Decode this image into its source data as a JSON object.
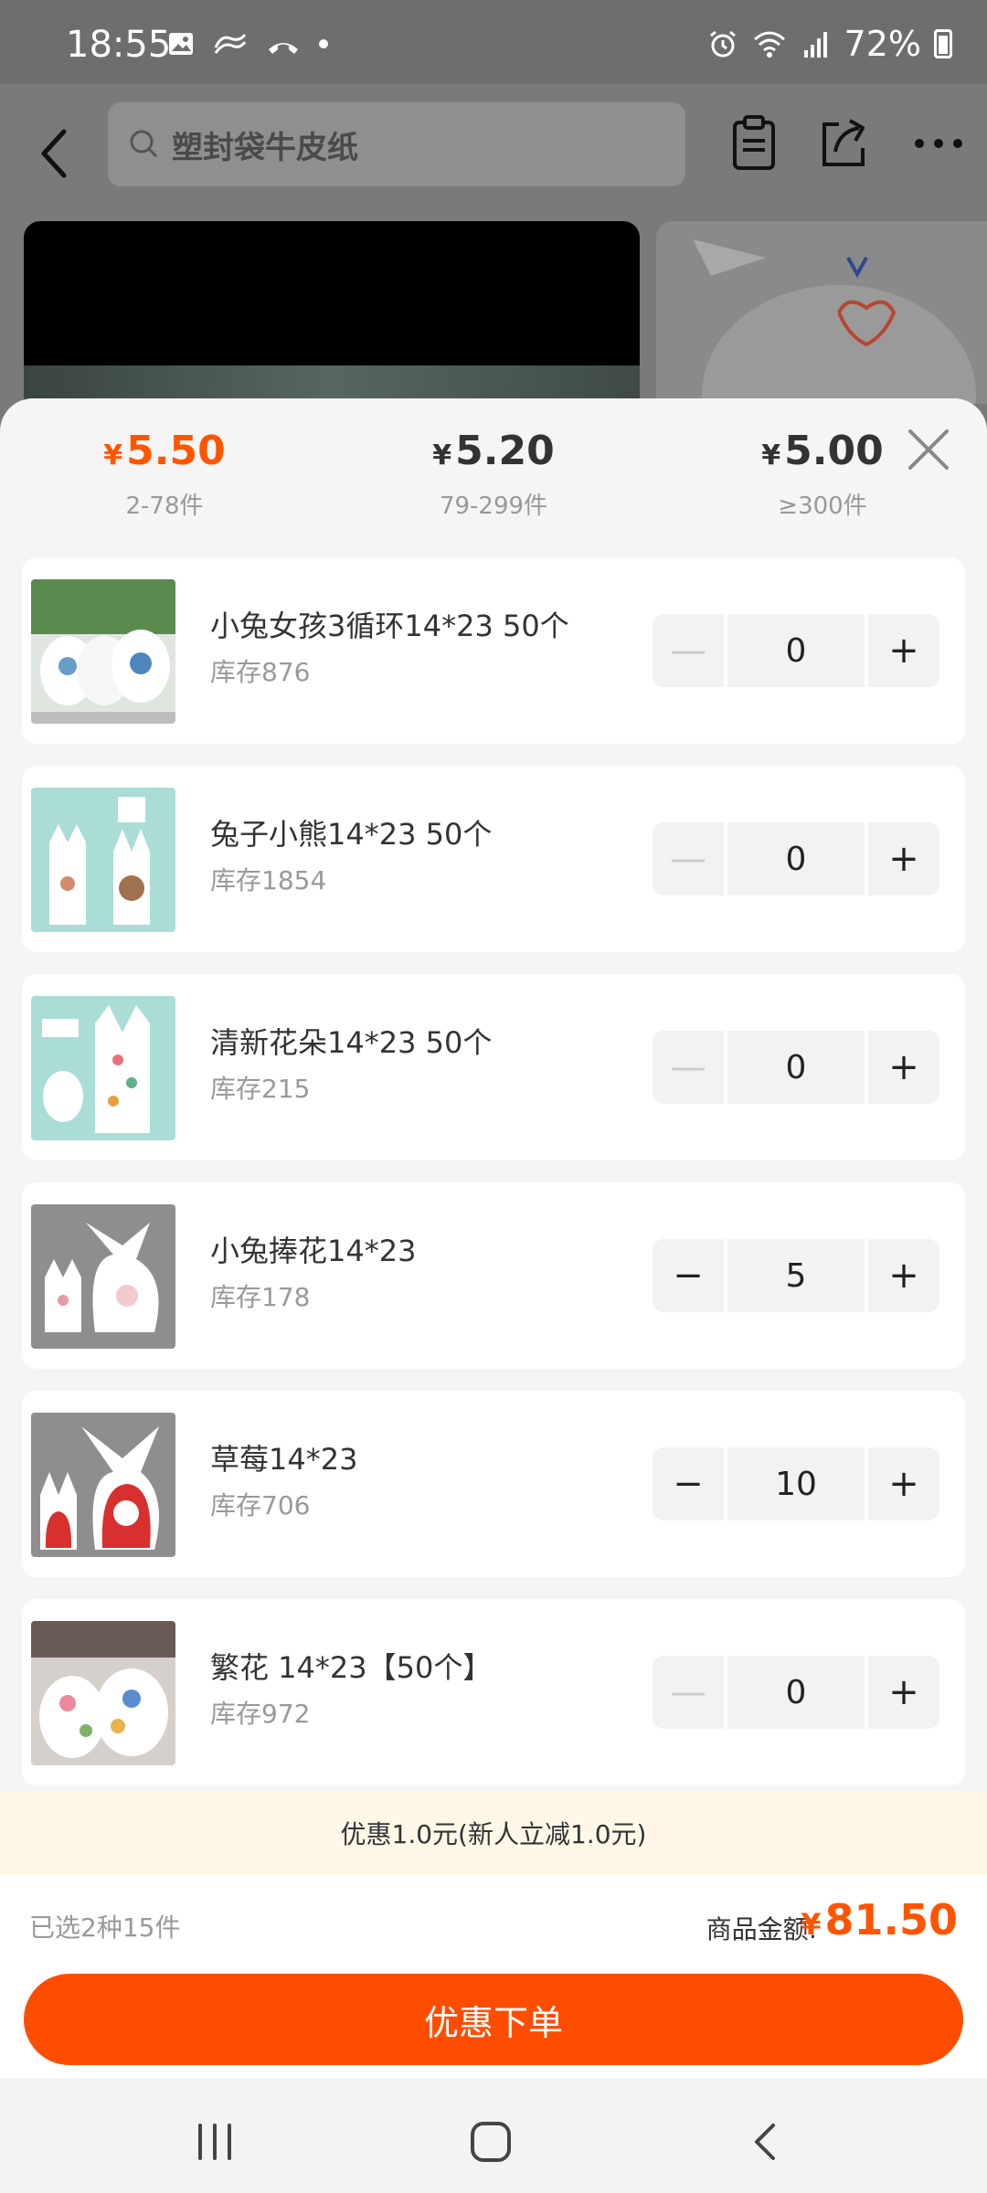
{
  "status": {
    "time": "18:55",
    "battery": "72%"
  },
  "header": {
    "search_placeholder": "塑封袋牛皮纸"
  },
  "tiers": [
    {
      "price": "5.50",
      "qty": "2-78件",
      "active": true
    },
    {
      "price": "5.20",
      "qty": "79-299件",
      "active": false
    },
    {
      "price": "5.00",
      "qty": "≥300件",
      "active": false
    }
  ],
  "currency": "¥",
  "items": [
    {
      "name": "小兔女孩3循环14*23  50个",
      "stock": "库存876",
      "qty": "0"
    },
    {
      "name": "兔子小熊14*23  50个",
      "stock": "库存1854",
      "qty": "0"
    },
    {
      "name": "清新花朵14*23  50个",
      "stock": "库存215",
      "qty": "0"
    },
    {
      "name": "小兔捧花14*23",
      "stock": "库存178",
      "qty": "5"
    },
    {
      "name": "草莓14*23",
      "stock": "库存706",
      "qty": "10"
    },
    {
      "name": "繁花 14*23【50个】",
      "stock": "库存972",
      "qty": "0"
    }
  ],
  "promo": "优惠1.0元(新人立减1.0元)",
  "summary": {
    "selected": "已选2种15件",
    "amount_label": "商品金额:",
    "amount": "81.50"
  },
  "cta": "优惠下单",
  "colors": {
    "accent": "#ff5500",
    "cta": "#ff4d00"
  }
}
